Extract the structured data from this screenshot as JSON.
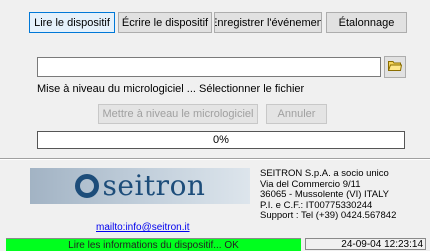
{
  "tabs": [
    {
      "label": "Lire le dispositif",
      "active": true
    },
    {
      "label": "Écrire le dispositif",
      "active": false
    },
    {
      "label": "Enregistrer l'événement",
      "active": false
    },
    {
      "label": "Étalonnage",
      "active": false
    }
  ],
  "firmware": {
    "file_path": "",
    "browse_icon": "folder-icon",
    "status": "Mise à niveau du micrologiciel ... Sélectionner le fichier",
    "upgrade_label": "Mettre à niveau le micrologiciel",
    "cancel_label": "Annuler",
    "progress_percent": 0,
    "progress_label": "0%"
  },
  "footer": {
    "logo_text": "seitron",
    "email": "mailto:info@seitron.it",
    "company_lines": [
      "SEITRON S.p.A. a socio unico",
      "Via del Commercio 9/11",
      "36065 - Mussolente (VI) ITALY",
      "P.I. e C.F.: IT00775330244",
      "Support : Tel (+39) 0424.567842"
    ]
  },
  "statusbar": {
    "message": "Lire les informations du dispositif... OK",
    "datetime": "24-09-04 12:23:14"
  },
  "colors": {
    "status_ok": "#00ff1e",
    "logo": "#1d4d7a"
  }
}
